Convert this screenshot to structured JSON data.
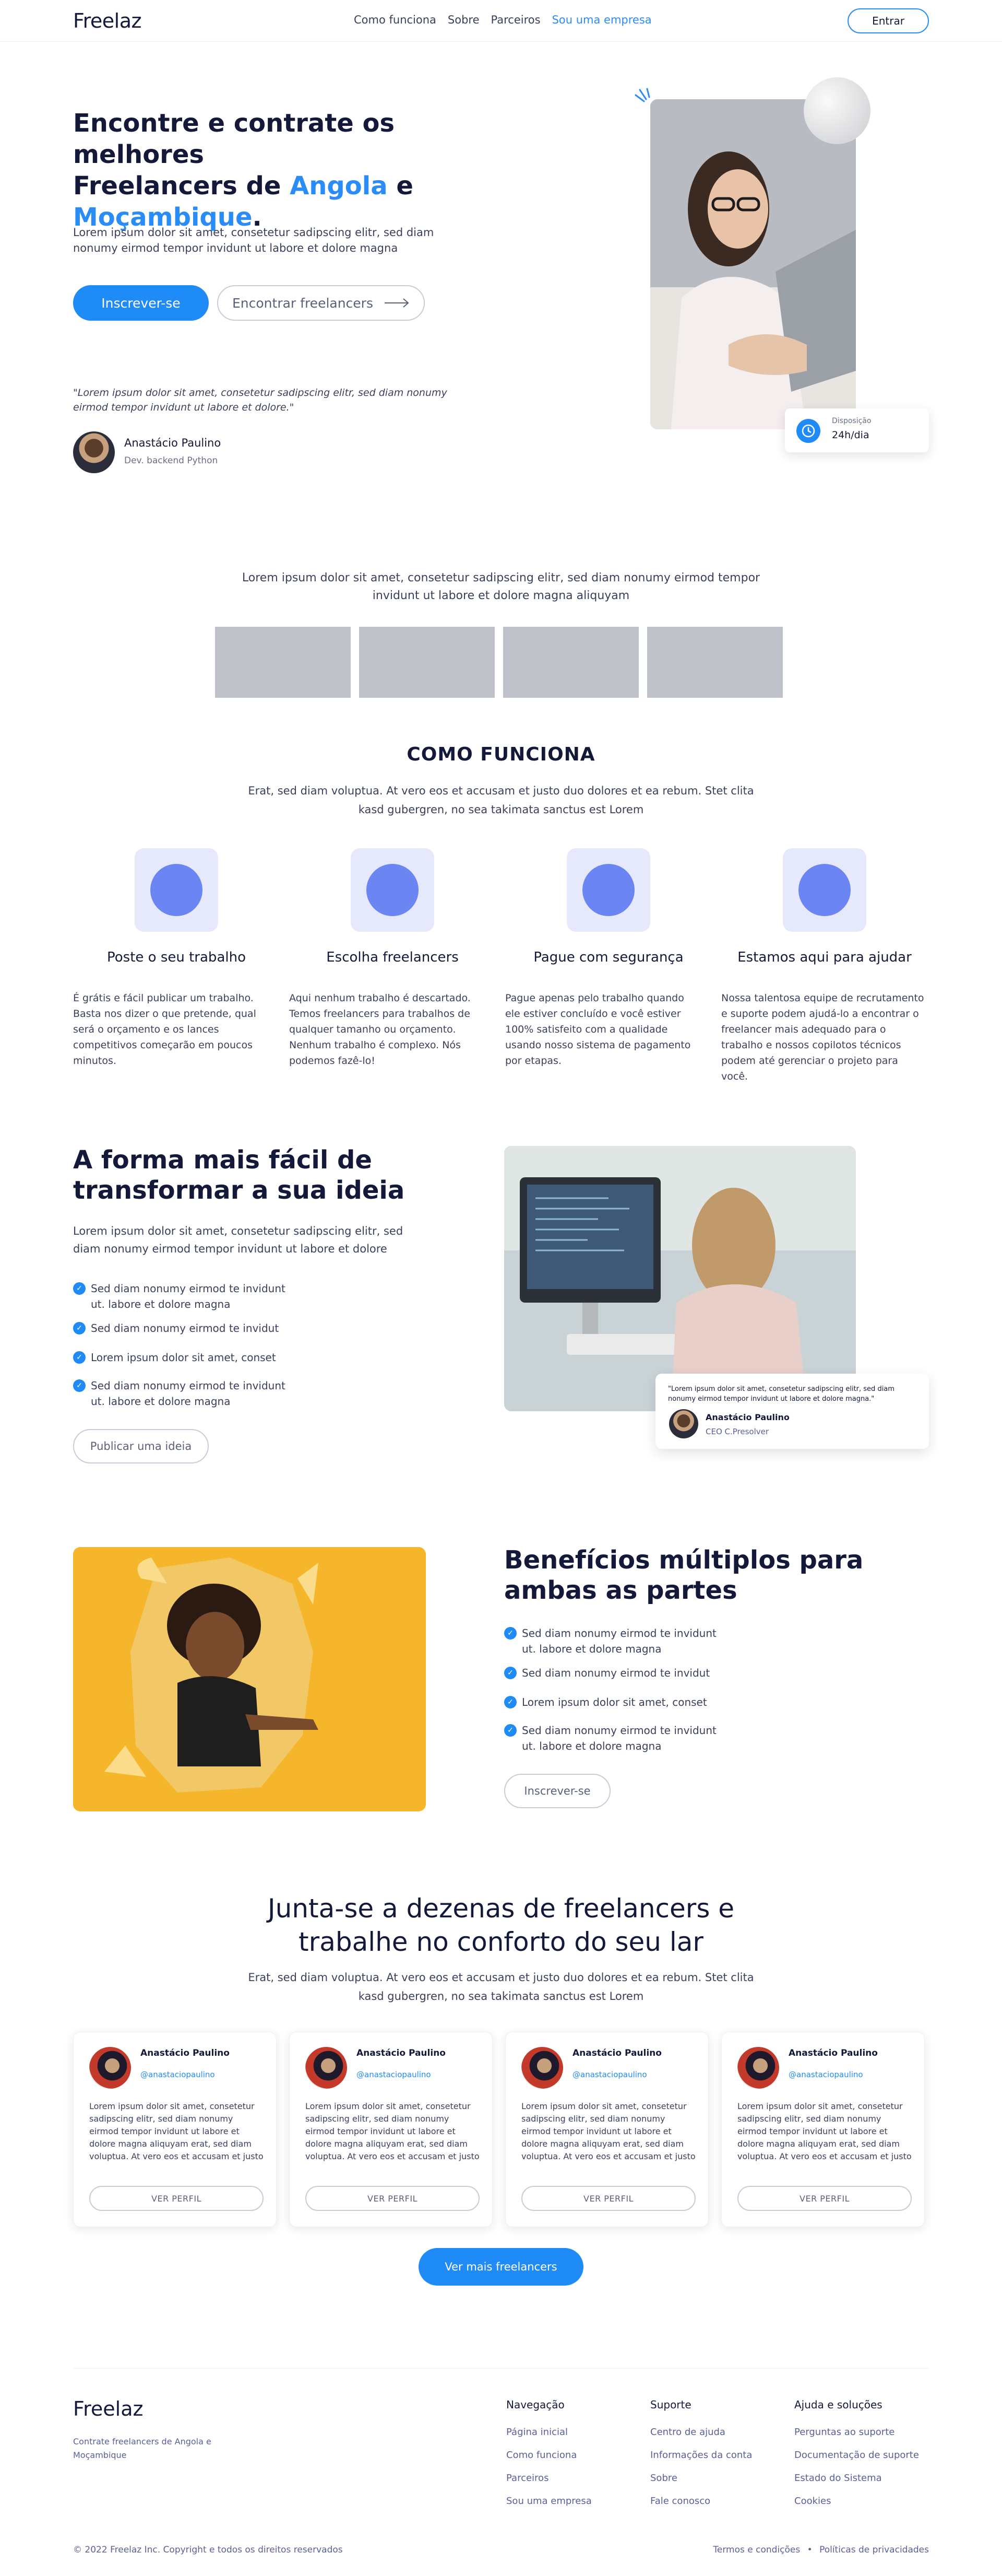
{
  "header": {
    "logo": "Freelaz",
    "nav": [
      "Como funciona",
      "Sobre",
      "Parceiros",
      "Sou uma empresa"
    ],
    "login_label": "Entrar"
  },
  "hero": {
    "title_line1": "Encontre e contrate os melhores",
    "title_line2_prefix": "Freelancers de ",
    "title_highlight1": "Angola",
    "title_line2_suffix": " e",
    "title_highlight2": "Moçambique",
    "title_end": ".",
    "subtitle": "Lorem ipsum dolor sit amet, consetetur sadipscing elitr, sed diam nonumy eirmod tempor invidunt ut labore et dolore magna",
    "cta_primary": "Inscrever-se",
    "cta_secondary": "Encontrar freelancers",
    "quote": "\"Lorem ipsum dolor sit amet, consetetur sadipscing elitr, sed diam nonumy eirmod tempor invidunt ut labore et dolore.\"",
    "person_name": "Anastácio Paulino",
    "person_role": "Dev. backend Python",
    "availability_label": "Disposição",
    "availability_value": "24h/dia"
  },
  "partners": {
    "text": "Lorem ipsum dolor sit amet, consetetur sadipscing elitr, sed diam nonumy eirmod tempor invidunt ut labore et dolore magna aliquyam"
  },
  "how": {
    "title": "COMO FUNCIONA",
    "subtitle": "Erat, sed diam voluptua. At vero eos et accusam et justo duo dolores et ea rebum. Stet clita kasd gubergren, no sea takimata sanctus est Lorem",
    "steps": [
      {
        "title": "Poste o seu trabalho",
        "text": "É grátis e fácil publicar um trabalho. Basta nos dizer o que pretende, qual será o orçamento e os lances competitivos começarão em poucos minutos."
      },
      {
        "title": "Escolha freelancers",
        "text": "Aqui nenhum trabalho é descartado. Temos freelancers para trabalhos de qualquer tamanho ou orçamento. Nenhum trabalho é complexo. Nós podemos fazê-lo!"
      },
      {
        "title": "Pague com segurança",
        "text": "Pague apenas pelo trabalho quando ele estiver concluído e você estiver 100% satisfeito com a qualidade usando nosso sistema de pagamento por etapas."
      },
      {
        "title": "Estamos aqui para ajudar",
        "text": "Nossa talentosa equipe de recrutamento e suporte podem ajudá-lo a encontrar o freelancer mais adequado para o trabalho e nossos copilotos técnicos podem até gerenciar o projeto para você."
      }
    ]
  },
  "idea": {
    "title_line1": "A forma mais fácil de",
    "title_line2": "transformar a sua ideia",
    "subtitle": "Lorem ipsum dolor sit amet, consetetur sadipscing elitr, sed diam nonumy eirmod tempor invidunt ut labore et dolore",
    "checks": [
      "Sed diam nonumy eirmod te invidunt ut. labore et dolore magna",
      "Sed diam nonumy eirmod te invidut",
      "Lorem ipsum dolor sit amet, conset",
      "Sed diam nonumy eirmod te invidunt ut. labore et dolore magna"
    ],
    "cta": "Publicar uma ideia",
    "quote": "\"Lorem ipsum dolor sit amet, consetetur sadipscing elitr, sed diam nonumy eirmod tempor invidunt ut labore et dolore magna.\"",
    "quote_name": "Anastácio Paulino",
    "quote_role": "CEO C.Presolver"
  },
  "benefits": {
    "title_line1": "Benefícios múltiplos para",
    "title_line2": "ambas as partes",
    "checks": [
      "Sed diam nonumy eirmod te invidunt ut. labore et dolore magna",
      "Sed diam nonumy eirmod te invidut",
      "Lorem ipsum dolor sit amet, conset",
      "Sed diam nonumy eirmod te invidunt ut. labore et dolore magna"
    ],
    "cta": "Inscrever-se"
  },
  "freelancers": {
    "title_line1": "Junta-se a dezenas de freelancers e",
    "title_line2": "trabalhe no conforto do seu lar",
    "subtitle": "Erat, sed diam voluptua. At vero eos et accusam et justo duo dolores et ea rebum. Stet clita kasd gubergren, no sea takimata sanctus est Lorem",
    "cards": [
      {
        "name": "Anastácio Paulino",
        "handle": "@anastaciopaulino",
        "bio": "Lorem ipsum dolor sit amet, consetetur sadipscing elitr, sed diam nonumy eirmod tempor invidunt ut labore et dolore magna aliquyam erat, sed diam voluptua. At vero eos et accusam et justo",
        "button": "VER PERFIL"
      },
      {
        "name": "Anastácio Paulino",
        "handle": "@anastaciopaulino",
        "bio": "Lorem ipsum dolor sit amet, consetetur sadipscing elitr, sed diam nonumy eirmod tempor invidunt ut labore et dolore magna aliquyam erat, sed diam voluptua. At vero eos et accusam et justo",
        "button": "VER PERFIL"
      },
      {
        "name": "Anastácio Paulino",
        "handle": "@anastaciopaulino",
        "bio": "Lorem ipsum dolor sit amet, consetetur sadipscing elitr, sed diam nonumy eirmod tempor invidunt ut labore et dolore magna aliquyam erat, sed diam voluptua. At vero eos et accusam et justo",
        "button": "VER PERFIL"
      },
      {
        "name": "Anastácio Paulino",
        "handle": "@anastaciopaulino",
        "bio": "Lorem ipsum dolor sit amet, consetetur sadipscing elitr, sed diam nonumy eirmod tempor invidunt ut labore et dolore magna aliquyam erat, sed diam voluptua. At vero eos et accusam et justo",
        "button": "VER PERFIL"
      }
    ],
    "cta": "Ver mais freelancers"
  },
  "footer": {
    "logo": "Freelaz",
    "description": "Contrate freelancers de Angola e Moçambique",
    "columns": [
      {
        "title": "Navegação",
        "links": [
          "Página inicial",
          "Como funciona",
          "Parceiros",
          "Sou uma empresa"
        ]
      },
      {
        "title": "Suporte",
        "links": [
          "Centro de ajuda",
          "Informações da conta",
          "Sobre",
          "Fale conosco"
        ]
      },
      {
        "title": "Ajuda e soluções",
        "links": [
          "Perguntas ao suporte",
          "Documentação de suporte",
          "Estado do Sistema",
          "Cookies"
        ]
      }
    ],
    "copyright": "© 2022 Freelaz Inc. Copyright e todos os direitos reservados",
    "terms": "Termos e condições",
    "separator": "•",
    "privacy": "Políticas de privacidades"
  },
  "colors": {
    "accent": "#1f8bf7",
    "text": "#14193a",
    "step_icon_bg": "#e6e8fb",
    "step_icon_dot": "#6b86f3",
    "placeholder": "#bfc1c8",
    "yellow": "#f6b62b"
  }
}
